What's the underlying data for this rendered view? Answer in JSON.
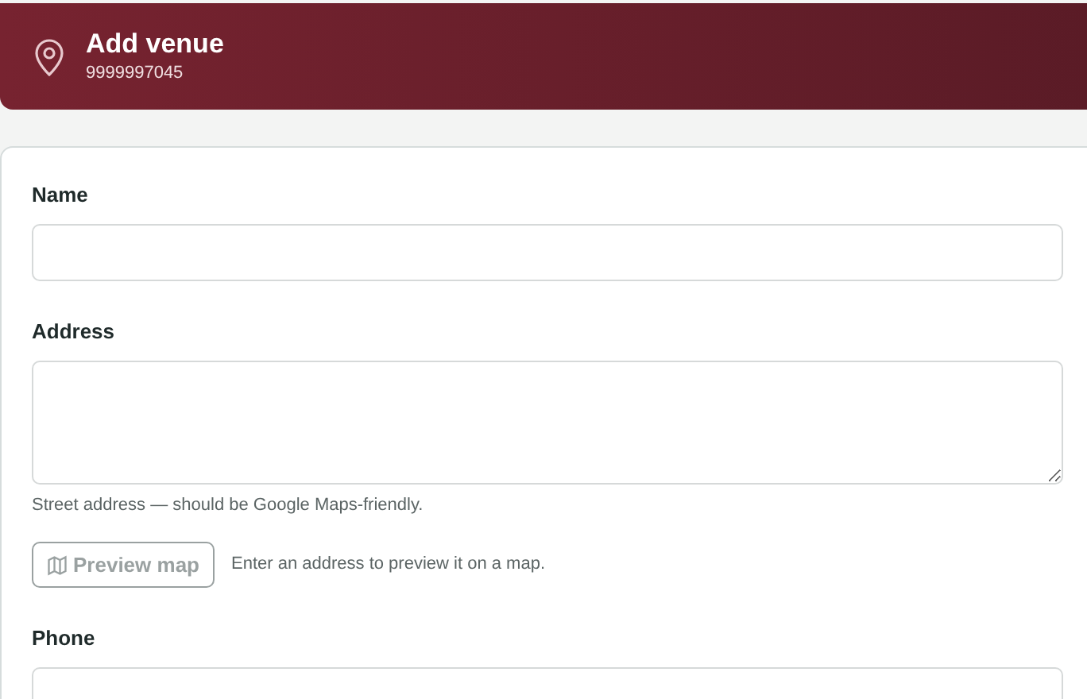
{
  "header": {
    "title": "Add venue",
    "subtitle": "9999997045"
  },
  "fields": [
    {
      "kind": "input",
      "label": "Name"
    },
    {
      "kind": "textarea",
      "label": "Address",
      "hint": "Street address — should be Google Maps-friendly.",
      "action": {
        "label": "Preview map",
        "disabled": true,
        "note": "Enter an address to preview it on a map."
      }
    },
    {
      "kind": "input",
      "label": "Phone"
    }
  ]
}
